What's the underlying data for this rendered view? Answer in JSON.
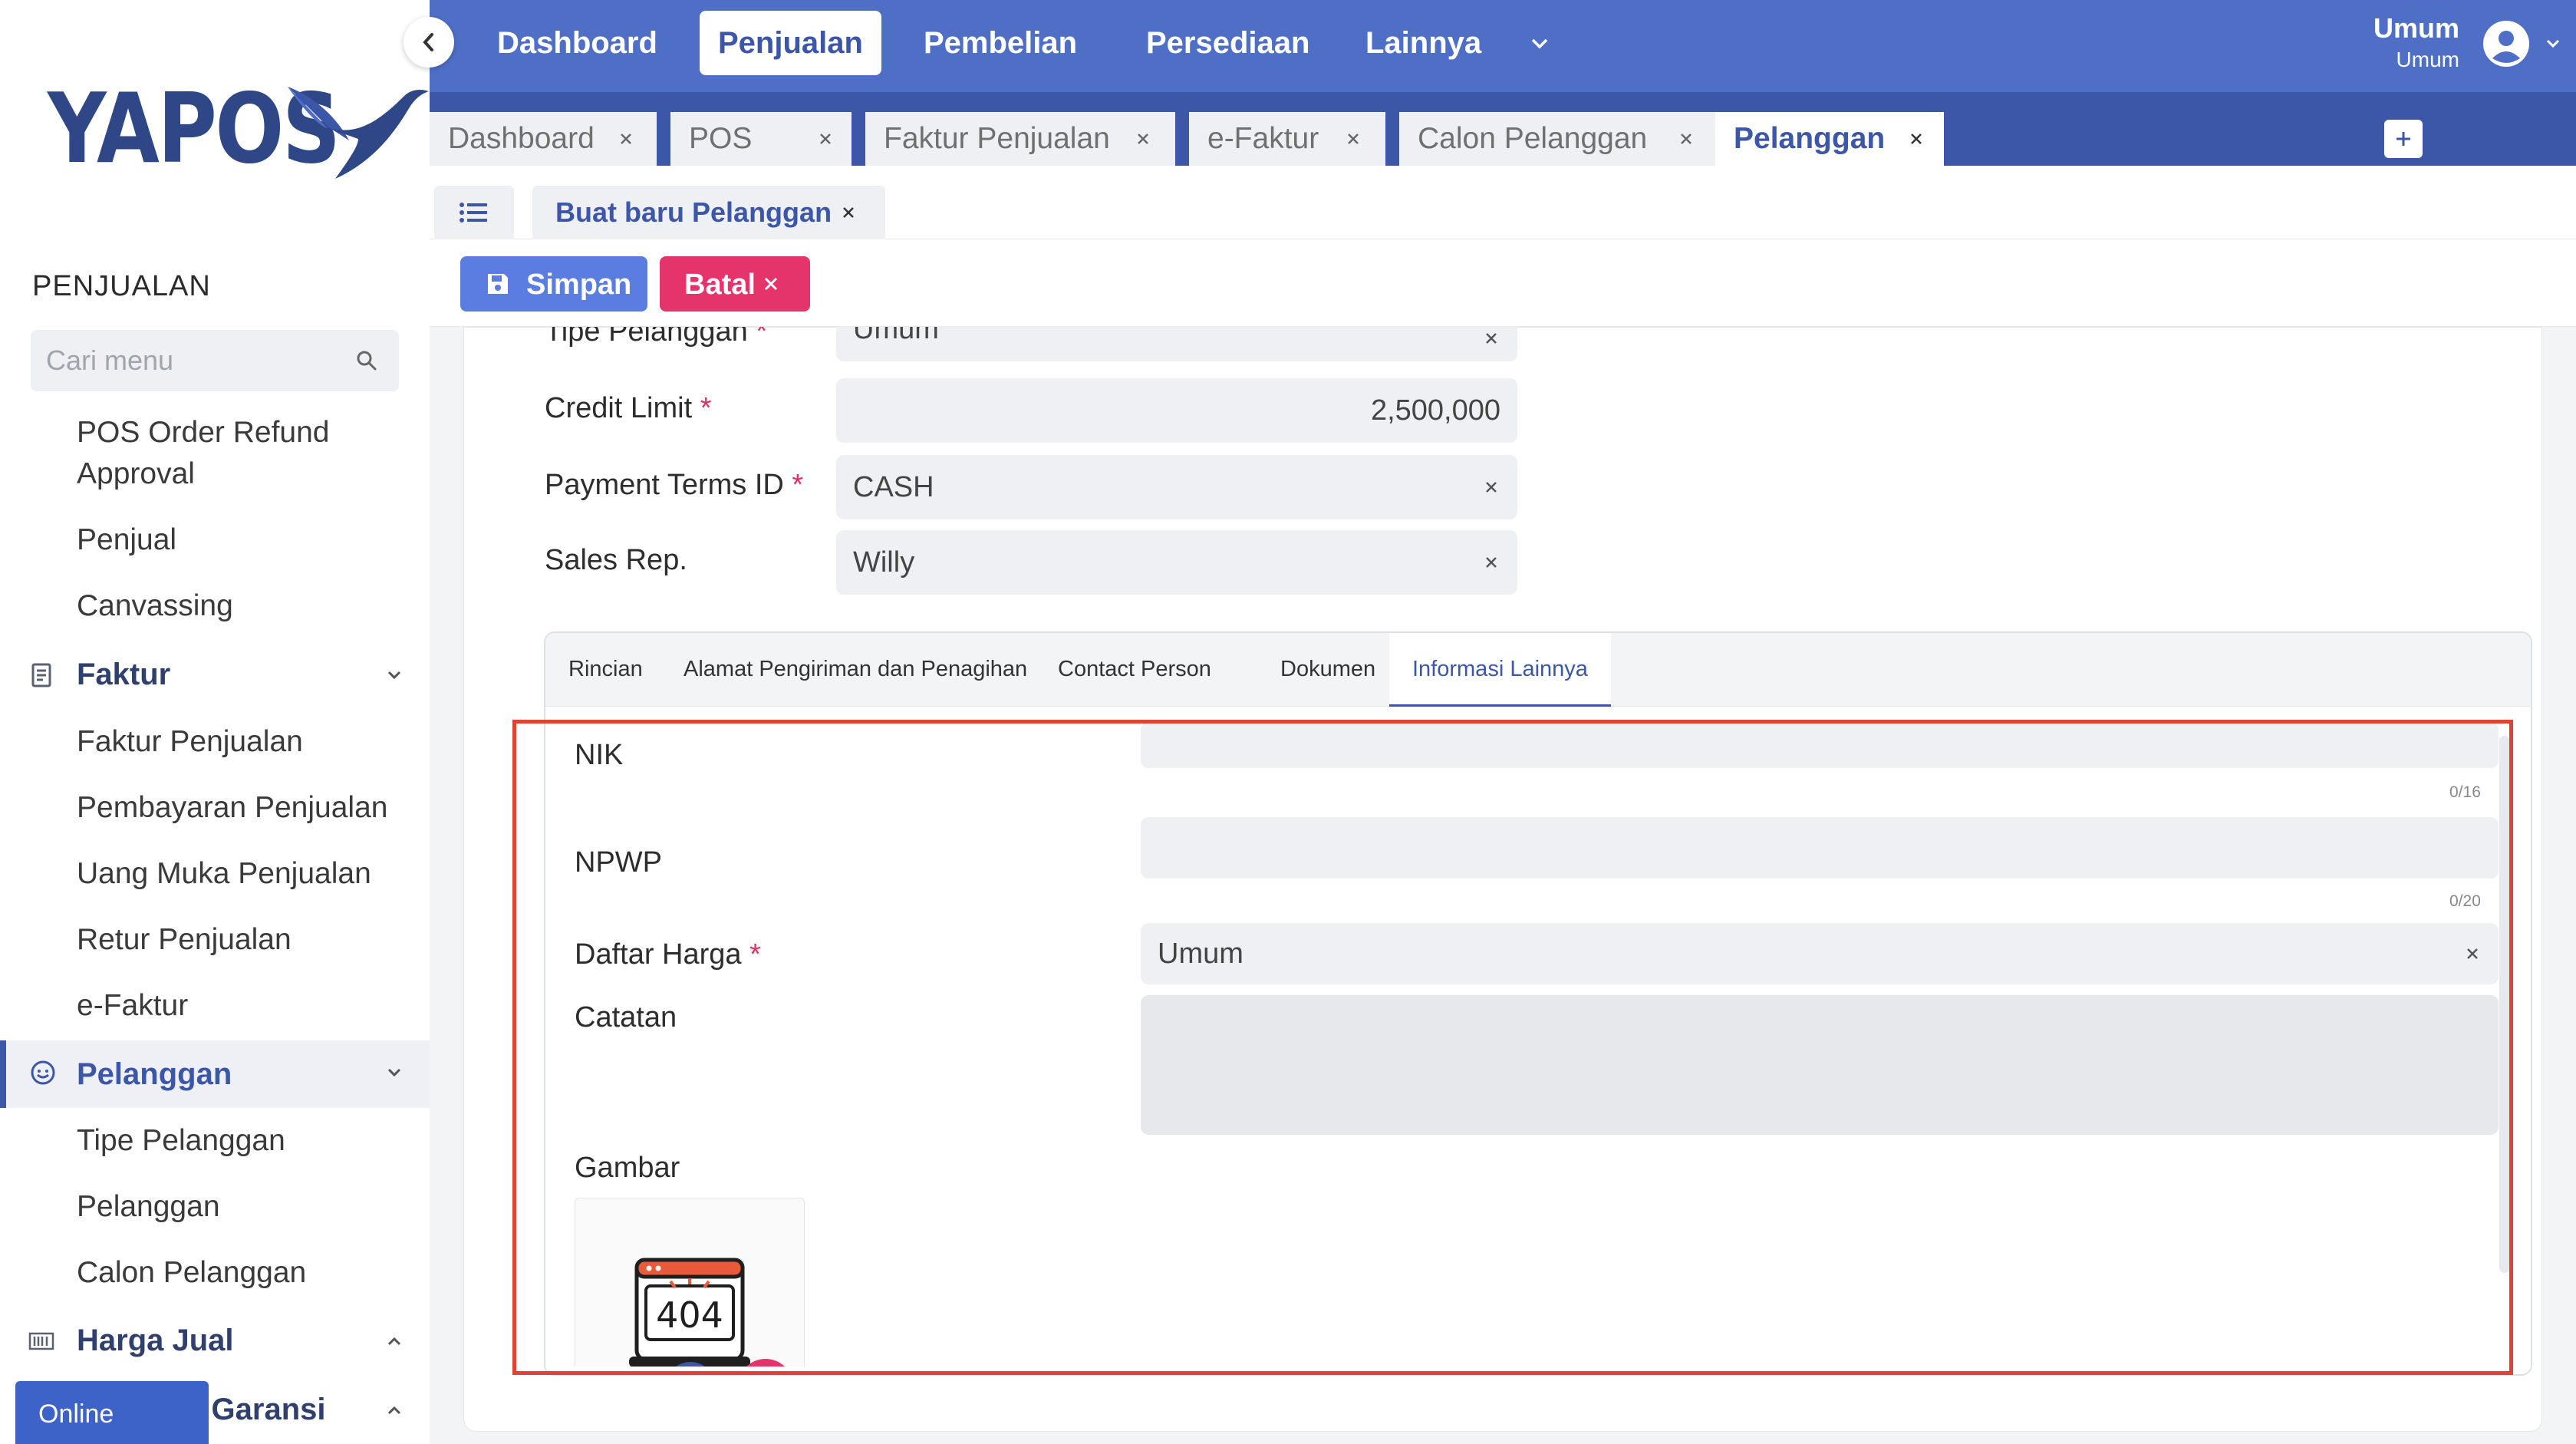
{
  "sidebar": {
    "logo_text": "YAPOS",
    "section_title": "PENJUALAN",
    "search_placeholder": "Cari menu",
    "items": [
      {
        "label": "POS Order Refund Approval"
      },
      {
        "label": "Penjual"
      },
      {
        "label": "Canvassing"
      }
    ],
    "groups": {
      "faktur": {
        "label": "Faktur",
        "items": [
          "Faktur Penjualan",
          "Pembayaran Penjualan",
          "Uang Muka Penjualan",
          "Retur Penjualan",
          "e-Faktur"
        ]
      },
      "pelanggan": {
        "label": "Pelanggan",
        "items": [
          "Tipe Pelanggan",
          "Pelanggan",
          "Calon Pelanggan"
        ]
      },
      "harga_jual": {
        "label": "Harga Jual"
      },
      "garansi": {
        "label": "n Garansi"
      }
    },
    "online_label": "Online"
  },
  "topnav": {
    "items": [
      "Dashboard",
      "Penjualan",
      "Pembelian",
      "Persediaan",
      "Lainnya"
    ],
    "active": "Penjualan",
    "user_name": "Umum",
    "user_role": "Umum"
  },
  "tabs": [
    "Dashboard",
    "POS",
    "Faktur Penjualan",
    "e-Faktur",
    "Calon Pelanggan",
    "Pelanggan"
  ],
  "active_tab": "Pelanggan",
  "subtab": {
    "label": "Buat baru Pelanggan"
  },
  "toolbar": {
    "save_label": "Simpan",
    "cancel_label": "Batal"
  },
  "form": {
    "tipe_pelanggan": {
      "label": "Tipe Pelanggan",
      "value": "Umum"
    },
    "credit_limit": {
      "label": "Credit Limit",
      "value": "2,500,000"
    },
    "payment_terms": {
      "label": "Payment Terms ID",
      "value": "CASH"
    },
    "sales_rep": {
      "label": "Sales Rep.",
      "value": "Willy"
    }
  },
  "detail_tabs": [
    "Rincian",
    "Alamat Pengiriman dan Penagihan",
    "Contact Person",
    "Dokumen",
    "Informasi Lainnya"
  ],
  "active_detail_tab": "Informasi Lainnya",
  "info": {
    "nik": {
      "label": "NIK",
      "value": "",
      "counter": "0/16"
    },
    "npwp": {
      "label": "NPWP",
      "value": "",
      "counter": "0/20"
    },
    "daftar_harga": {
      "label": "Daftar Harga",
      "value": "Umum"
    },
    "catatan": {
      "label": "Catatan",
      "value": ""
    },
    "gambar": {
      "label": "Gambar",
      "placeholder_text": "404"
    }
  },
  "colors": {
    "primary": "#3d57a8",
    "nav_bg": "#4f6fc7",
    "save_button": "#5b7ce0",
    "cancel_button": "#e5336b",
    "required": "#e03060",
    "highlight": "#e04335"
  }
}
